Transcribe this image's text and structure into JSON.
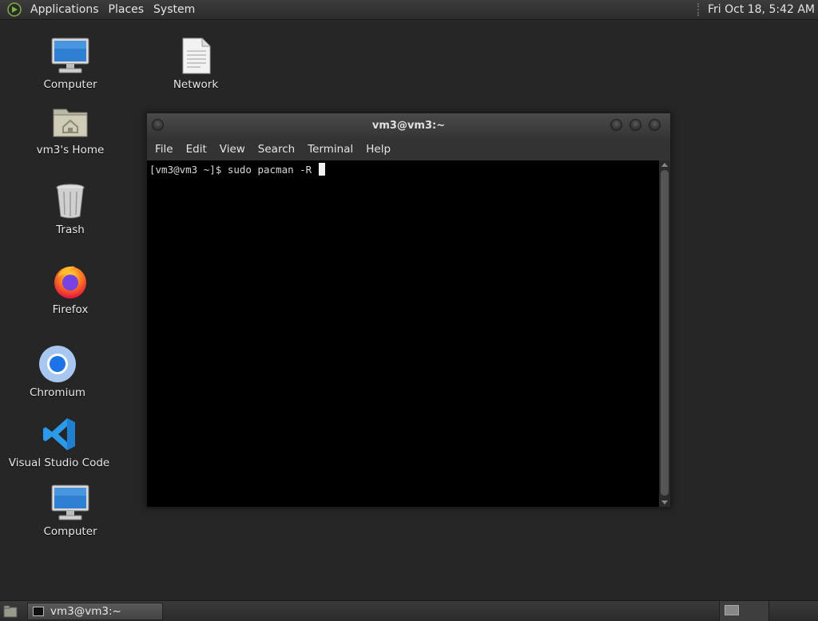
{
  "top_panel": {
    "menus": [
      "Applications",
      "Places",
      "System"
    ],
    "clock": "Fri Oct 18,  5:42 AM",
    "logo_icon": "mate-logo-icon"
  },
  "desktop_icons": [
    {
      "label": "Computer",
      "icon": "computer-icon"
    },
    {
      "label": "Network",
      "icon": "network-icon"
    },
    {
      "label": "vm3's Home",
      "icon": "home-folder-icon"
    },
    {
      "label": "Trash",
      "icon": "trash-icon"
    },
    {
      "label": "Firefox",
      "icon": "firefox-icon"
    },
    {
      "label": "Chromium",
      "icon": "chromium-icon"
    },
    {
      "label": "Visual Studio Code",
      "icon": "vscode-icon"
    },
    {
      "label": "Computer",
      "icon": "computer-icon"
    }
  ],
  "terminal": {
    "title": "vm3@vm3:~",
    "menu": [
      "File",
      "Edit",
      "View",
      "Search",
      "Terminal",
      "Help"
    ],
    "prompt_line": "[vm3@vm3 ~]$ sudo pacman -R "
  },
  "taskbar": {
    "task_label": "vm3@vm3:~",
    "workspaces": 2
  },
  "colors": {
    "desktop_bg": "#262626",
    "panel_bg": "#333333",
    "terminal_bg": "#000000",
    "terminal_fg": "#d8d8d8"
  }
}
